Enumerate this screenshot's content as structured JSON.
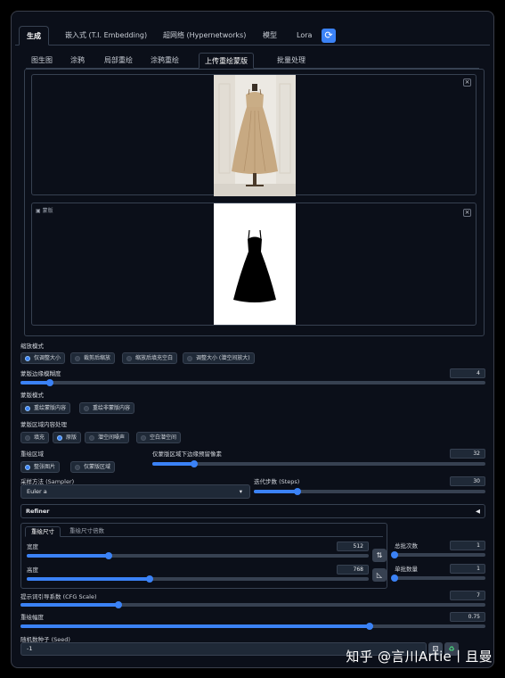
{
  "main_tabs": [
    "生成",
    "嵌入式 (T.I. Embedding)",
    "超网络 (Hypernetworks)",
    "模型",
    "Lora"
  ],
  "sub_tabs": [
    "图生图",
    "涂鸦",
    "局部重绘",
    "涂鸦重绘",
    "上传重绘蒙版",
    "批量处理"
  ],
  "mask_label": "蒙版",
  "resize_mode": {
    "label": "缩放模式",
    "options": [
      "仅调整大小",
      "裁剪后缩放",
      "缩放后填充空白",
      "调整大小 (潜空间放大)"
    ],
    "selected": 0
  },
  "mask_blur": {
    "label": "蒙版边缘模糊度",
    "value": "4",
    "fraction": 0.063
  },
  "mask_mode": {
    "label": "蒙版模式",
    "options": [
      "重绘蒙版内容",
      "重绘非蒙版内容"
    ],
    "selected": 0
  },
  "masked_content": {
    "label": "蒙版区域内容处理",
    "options": [
      "填充",
      "原版",
      "潜空间噪声",
      "空白潜空间"
    ],
    "selected": 1
  },
  "inpaint_area": {
    "label": "重绘区域",
    "options": [
      "整张图片",
      "仅蒙版区域"
    ],
    "selected": 0
  },
  "only_masked_padding": {
    "label": "仅蒙版区域下边缘预留像素",
    "value": "32",
    "fraction": 0.125
  },
  "sampler": {
    "label": "采样方法 (Sampler)",
    "value": "Euler a"
  },
  "steps": {
    "label": "迭代步数 (Steps)",
    "value": "30",
    "fraction": 0.19
  },
  "refiner": {
    "label": "Refiner",
    "arrow": "◀"
  },
  "size_tabs": [
    "重绘尺寸",
    "重绘尺寸倍数"
  ],
  "width": {
    "label": "宽度",
    "value": "512",
    "fraction": 0.24
  },
  "height": {
    "label": "高度",
    "value": "768",
    "fraction": 0.36
  },
  "batch_count": {
    "label": "总批次数",
    "value": "1",
    "fraction": 0.0
  },
  "batch_size": {
    "label": "单批数量",
    "value": "1",
    "fraction": 0.0
  },
  "cfg_scale": {
    "label": "提示词引导系数 (CFG Scale)",
    "value": "7",
    "fraction": 0.21
  },
  "denoise": {
    "label": "重绘幅度",
    "value": "0.75",
    "fraction": 0.75
  },
  "seed": {
    "label": "随机数种子 (Seed)",
    "value": "-1"
  },
  "icons": {
    "swap": "⇅",
    "ratio": "◺",
    "refresh": "⟳",
    "dice": "🎲",
    "recycle": "♻"
  },
  "watermark": "知乎 @言川Artie丨且曼"
}
